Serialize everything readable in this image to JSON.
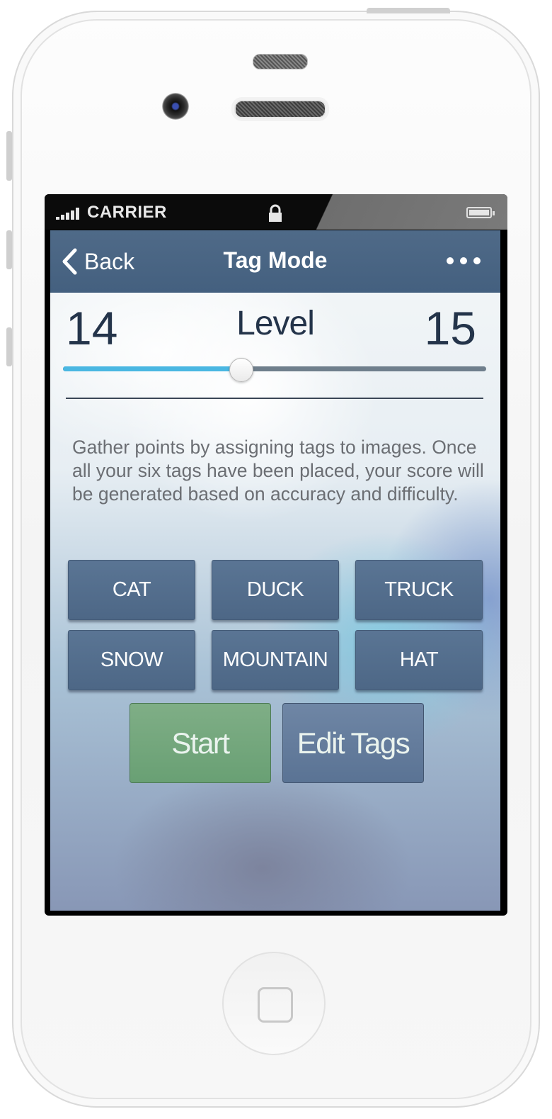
{
  "status_bar": {
    "carrier": "CARRIER",
    "signal_icon": "signal-bars-icon",
    "lock_icon": "lock-icon",
    "battery_icon": "battery-icon"
  },
  "nav": {
    "back_label": "Back",
    "title": "Tag Mode",
    "more_icon": "ellipsis-icon"
  },
  "level": {
    "title": "Level",
    "min": "14",
    "max": "15",
    "progress": 0.42
  },
  "description": "Gather points by assigning tags to images. Once all your six tags have been placed, your score will be generated based on accuracy and difficulty.",
  "tags": [
    "CAT",
    "DUCK",
    "TRUCK",
    "SNOW",
    "MOUNTAIN",
    "HAT"
  ],
  "actions": {
    "start_label": "Start",
    "edit_label": "Edit Tags"
  },
  "colors": {
    "nav_bar": "#4a6584",
    "slider_fill": "#4ab7e2",
    "tag_button": "#546f8e",
    "start_button": "#74a77d",
    "edit_button": "#6480a0"
  }
}
